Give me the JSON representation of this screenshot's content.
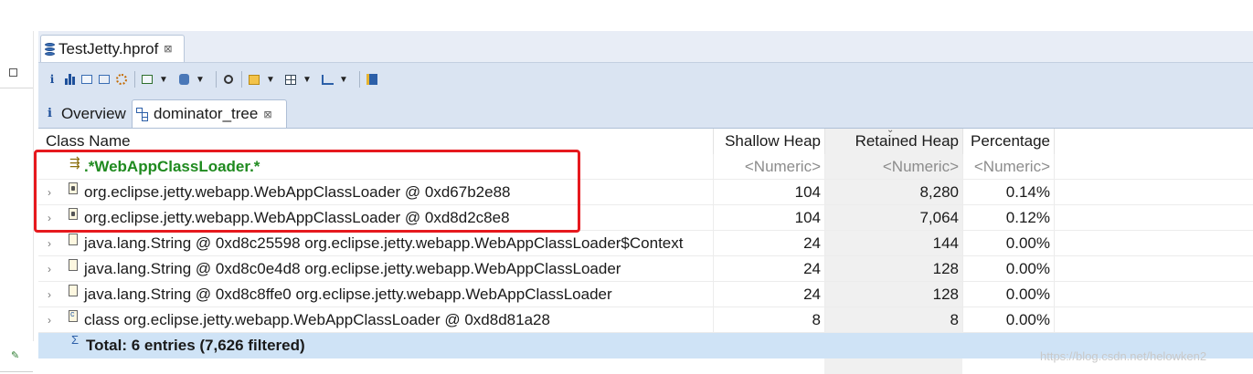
{
  "editor": {
    "file_tab": "TestJetty.hprof",
    "file_tab_close": "⊠"
  },
  "toolbar": {
    "info_glyph": "i"
  },
  "inner_tabs": [
    {
      "label": "Overview",
      "icon": "info-icon"
    },
    {
      "label": "dominator_tree",
      "icon": "tree-icon",
      "close": "⊠"
    }
  ],
  "table": {
    "columns": [
      "Class Name",
      "Shallow Heap",
      "Retained Heap",
      "Percentage"
    ],
    "sort_indicator": "⌄",
    "filter_row": {
      "name": ".*WebAppClassLoader.*",
      "shallow": "<Numeric>",
      "retained": "<Numeric>",
      "percentage": "<Numeric>"
    },
    "rows": [
      {
        "name": "org.eclipse.jetty.webapp.WebAppClassLoader @ 0xd67b2e88",
        "shallow": "104",
        "retained": "8,280",
        "percentage": "0.14%",
        "icon": "classloader-icon",
        "expander": "›"
      },
      {
        "name": "org.eclipse.jetty.webapp.WebAppClassLoader @ 0xd8d2c8e8",
        "shallow": "104",
        "retained": "7,064",
        "percentage": "0.12%",
        "icon": "classloader-icon",
        "expander": "›"
      },
      {
        "name": "java.lang.String @ 0xd8c25598  org.eclipse.jetty.webapp.WebAppClassLoader$Context",
        "shallow": "24",
        "retained": "144",
        "percentage": "0.00%",
        "icon": "object-icon",
        "expander": "›"
      },
      {
        "name": "java.lang.String @ 0xd8c0e4d8  org.eclipse.jetty.webapp.WebAppClassLoader",
        "shallow": "24",
        "retained": "128",
        "percentage": "0.00%",
        "icon": "object-icon",
        "expander": "›"
      },
      {
        "name": "java.lang.String @ 0xd8c8ffe0  org.eclipse.jetty.webapp.WebAppClassLoader",
        "shallow": "24",
        "retained": "128",
        "percentage": "0.00%",
        "icon": "object-icon",
        "expander": "›"
      },
      {
        "name": "class org.eclipse.jetty.webapp.WebAppClassLoader @ 0xd8d81a28",
        "shallow": "8",
        "retained": "8",
        "percentage": "0.00%",
        "icon": "class-icon",
        "expander": "›"
      }
    ],
    "total": {
      "sigma": "Σ",
      "label": "Total: 6 entries (7,626 filtered)"
    }
  },
  "watermark": "https://blog.csdn.net/helowken2",
  "colors": {
    "highlight_border": "#e6191e",
    "filter_text": "#1f8a1f",
    "total_row_bg": "#cfe3f6",
    "toolbar_bg": "#dae4f2"
  }
}
